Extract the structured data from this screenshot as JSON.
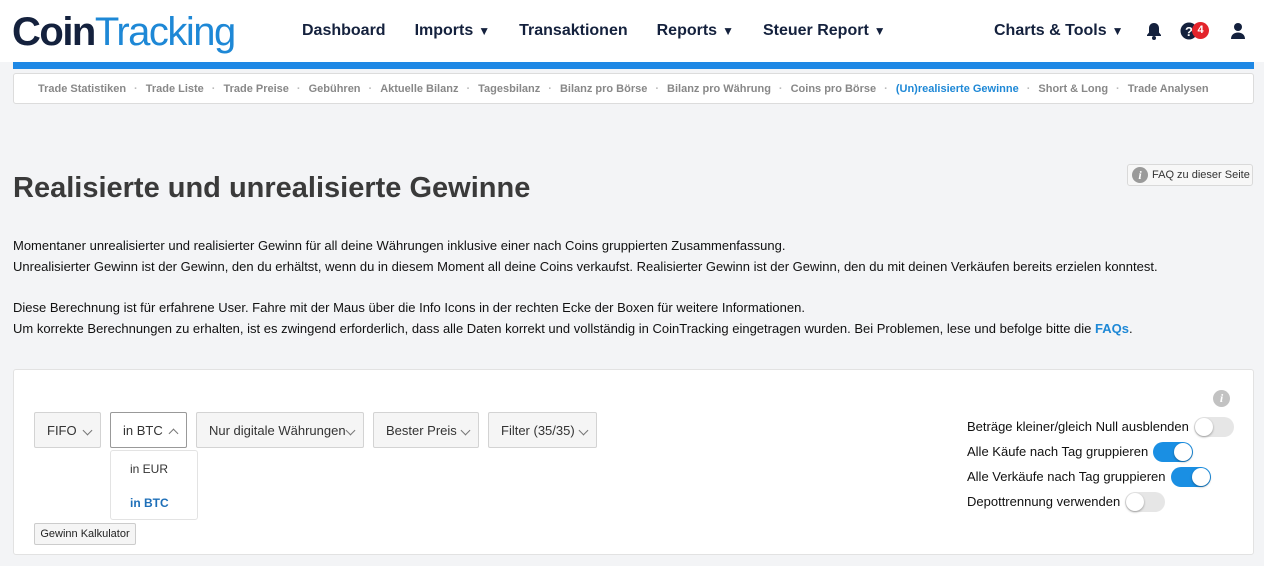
{
  "brand": {
    "logo_part1": "Coin",
    "logo_part2": "Tracking"
  },
  "nav": {
    "dashboard": "Dashboard",
    "imports": "Imports",
    "transaktionen": "Transaktionen",
    "reports": "Reports",
    "steuer_report": "Steuer Report",
    "charts_tools": "Charts & Tools",
    "caret": "▼",
    "notification_count": "4"
  },
  "subnav": {
    "items": [
      "Trade Statistiken",
      "Trade Liste",
      "Trade Preise",
      "Gebühren",
      "Aktuelle Bilanz",
      "Tagesbilanz",
      "Bilanz pro Börse",
      "Bilanz pro Währung",
      "Coins pro Börse",
      "(Un)realisierte Gewinne",
      "Short & Long",
      "Trade Analysen"
    ],
    "active_index": 9,
    "separator": "·"
  },
  "faq_button": "FAQ zu dieser Seite",
  "page_title": "Realisierte und unrealisierte Gewinne",
  "description": {
    "line1": "Momentaner unrealisierter und realisierter Gewinn für all deine Währungen inklusive einer nach Coins gruppierten Zusammenfassung.",
    "line2": "Unrealisierter Gewinn ist der Gewinn, den du erhältst, wenn du in diesem Moment all deine Coins verkaufst. Realisierter Gewinn ist der Gewinn, den du mit deinen Verkäufen bereits erzielen konntest.",
    "line3": "Diese Berechnung ist für erfahrene User. Fahre mit der Maus über die Info Icons in der rechten Ecke der Boxen für weitere Informationen.",
    "line4": "Um korrekte Berechnungen zu erhalten, ist es zwingend erforderlich, dass alle Daten korrekt und vollständig in CoinTracking eingetragen wurden. Bei Problemen, lese und befolge bitte die",
    "line4_link": "FAQs",
    "line4_end": "."
  },
  "controls": {
    "method": "FIFO",
    "currency": "in BTC",
    "currency_options": [
      "in EUR",
      "in BTC"
    ],
    "currency_selected_index": 1,
    "currencies_filter": "Nur digitale Währungen",
    "price": "Bester Preis",
    "filter": "Filter (35/35)",
    "calculator_button": "Gewinn Kalkulator"
  },
  "toggles": [
    {
      "label": "Beträge kleiner/gleich Null ausblenden",
      "on": false
    },
    {
      "label": "Alle Käufe nach Tag gruppieren",
      "on": true
    },
    {
      "label": "Alle Verkäufe nach Tag gruppieren",
      "on": true
    },
    {
      "label": "Depottrennung verwenden",
      "on": false
    }
  ],
  "colors": {
    "brand_dark": "#14213d",
    "brand_blue": "#1e88e5",
    "link": "#1e88d6",
    "badge": "#e3242b"
  }
}
